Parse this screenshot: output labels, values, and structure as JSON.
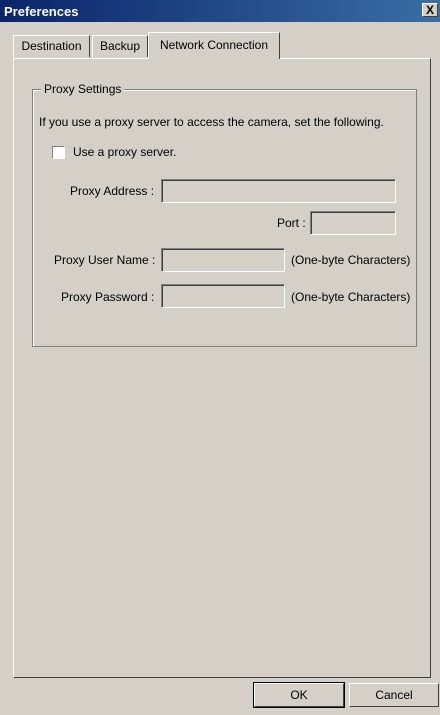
{
  "window": {
    "title": "Preferences",
    "close_label": "X"
  },
  "tabs": [
    {
      "label": "Destination",
      "active": false
    },
    {
      "label": "Backup",
      "active": false
    },
    {
      "label": "Network Connection",
      "active": true
    }
  ],
  "proxy": {
    "group_title": "Proxy Settings",
    "description": "If you use a proxy server to access the camera, set the following.",
    "use_proxy_label": "Use a proxy server.",
    "use_proxy_checked": false,
    "address_label": "Proxy Address :",
    "address_value": "",
    "port_label": "Port :",
    "port_value": "",
    "user_label": "Proxy User Name :",
    "user_value": "",
    "user_hint": "(One-byte Characters)",
    "password_label": "Proxy Password :",
    "password_value": "",
    "password_hint": "(One-byte Characters)"
  },
  "buttons": {
    "ok": "OK",
    "cancel": "Cancel"
  }
}
